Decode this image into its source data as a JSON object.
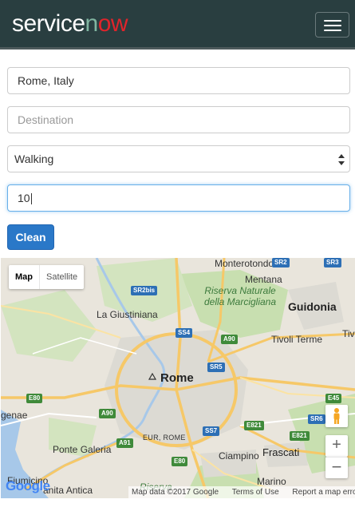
{
  "header": {
    "logo": {
      "part1": "service",
      "part2": "n",
      "part3": "ow"
    }
  },
  "form": {
    "origin_value": "Rome, Italy",
    "destination_placeholder": "Destination",
    "mode_selected": "Walking",
    "distance_value": "10",
    "clean_label": "Clean"
  },
  "map": {
    "type_map": "Map",
    "type_satellite": "Satellite",
    "places": {
      "monterotondo": "Monterotondo",
      "mentana": "Mentana",
      "riserva": "Riserva Naturale della Marcigliana",
      "guidonia": "Guidonia",
      "la_giustiniana": "La Giustiniana",
      "tivoli_terme": "Tivoli Terme",
      "tiv": "Tiv",
      "rome": "Rome",
      "genae": "genae",
      "eur_rome": "EUR, ROME",
      "ponte_galeria": "Ponte Galeria",
      "ciampino": "Ciampino",
      "frascati": "Frascati",
      "fiumicino": "Fiumicino",
      "sanita_antica": "anita Antica",
      "marino": "Marino",
      "riserva_bottom": "Riserva"
    },
    "roads": {
      "sr2bis": "SR2bis",
      "ss4": "SS4",
      "a90_top": "A90",
      "sr5": "SR5",
      "e80_left": "E80",
      "a90_left": "A90",
      "ss7": "SS7",
      "e821_a": "E821",
      "e821_b": "E821",
      "a91": "A91",
      "e80_bottom": "E80",
      "e45": "E45",
      "sr6": "SR6",
      "sr3": "SR3",
      "sr2": "SR2"
    },
    "zoom_in": "+",
    "zoom_out": "−",
    "footer": {
      "data": "Map data ©2017 Google",
      "terms": "Terms of Use",
      "report": "Report a map error"
    },
    "google_logo": "Google",
    "colors": {
      "water": "#a7c8e9",
      "park": "#c8dfb0",
      "road": "#f6c868",
      "urban": "#dcdad3"
    }
  }
}
